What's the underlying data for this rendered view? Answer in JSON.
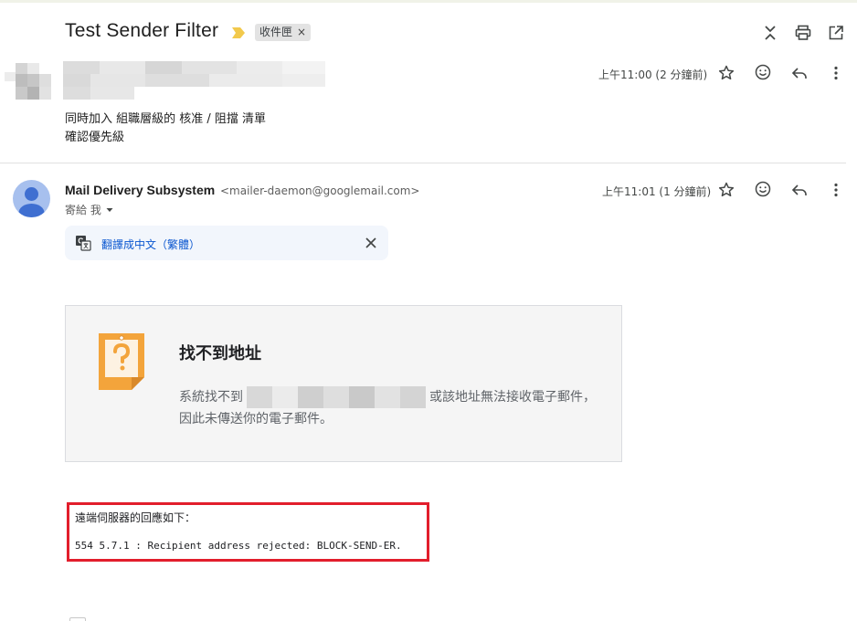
{
  "thread": {
    "subject": "Test Sender Filter",
    "label_chip": "收件匣",
    "label_chip_remove": "×"
  },
  "message1": {
    "time": "上午11:00 (2 分鐘前)",
    "snippet_line1": "同時加入 組職層級的 核准 / 阻擋 清單",
    "snippet_line2": "確認優先級"
  },
  "message2": {
    "from_name": "Mail Delivery Subsystem",
    "from_email": "<mailer-daemon@googlemail.com>",
    "to_line": "寄給 我",
    "time": "上午11:01 (1 分鐘前)",
    "translate_link": "翻譯成中文（繁體）"
  },
  "card": {
    "title": "找不到地址",
    "body_prefix": "系統找不到",
    "body_suffix": "或該地址無法接收電子郵件，因此未傳送你的電子郵件。"
  },
  "response": {
    "heading": "遠端伺服器的回應如下：",
    "code": "554 5.7.1 : Recipient address rejected: BLOCK-SEND-ER."
  },
  "colors": {
    "link_blue": "#0b57d0",
    "highlight_red": "#e21e2c",
    "card_icon_orange": "#f3a43b",
    "avatar_blue": "#a7c0ee",
    "importance_yellow": "#f2c94c"
  },
  "icons": {
    "importance": "importance-marker-icon",
    "expand": "expand-collapse-icon",
    "print": "print-icon",
    "new_window": "open-in-new-window-icon",
    "star": "star-icon",
    "emoji": "emoji-reaction-icon",
    "reply": "reply-icon",
    "more": "more-vert-icon",
    "translate": "translate-icon",
    "close": "close-icon",
    "card": "question-note-icon",
    "dropdown": "dropdown-arrow-icon"
  }
}
